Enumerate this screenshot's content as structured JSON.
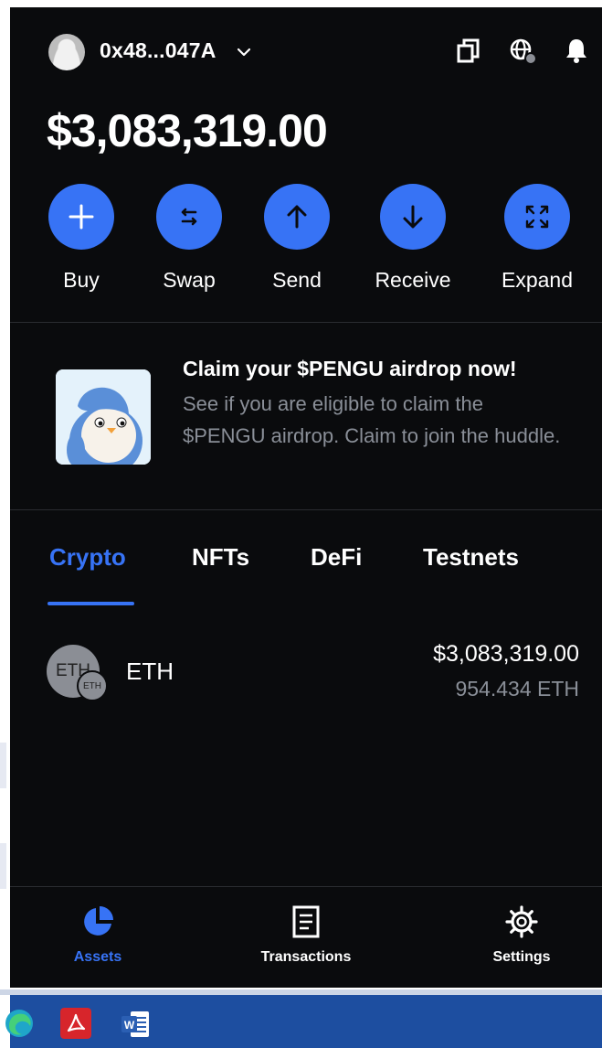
{
  "header": {
    "account_label": "0x48...047A",
    "icons": [
      "avatar",
      "chevron-down-icon",
      "copy-icon",
      "globe-icon",
      "bell-icon"
    ]
  },
  "balance": "$3,083,319.00",
  "actions": [
    {
      "label": "Buy",
      "icon": "plus-icon"
    },
    {
      "label": "Swap",
      "icon": "swap-icon"
    },
    {
      "label": "Send",
      "icon": "arrow-up-icon"
    },
    {
      "label": "Receive",
      "icon": "arrow-down-icon"
    },
    {
      "label": "Expand",
      "icon": "expand-icon"
    }
  ],
  "promo": {
    "title": "Claim your $PENGU airdrop now!",
    "description": "See if you are eligible to claim the $PENGU airdrop. Claim to join the huddle."
  },
  "tabs": [
    {
      "label": "Crypto",
      "active": true
    },
    {
      "label": "NFTs",
      "active": false
    },
    {
      "label": "DeFi",
      "active": false
    },
    {
      "label": "Testnets",
      "active": false
    }
  ],
  "assets": [
    {
      "icon_text": "ETH",
      "badge_text": "ETH",
      "name": "ETH",
      "value": "$3,083,319.00",
      "amount": "954.434 ETH"
    }
  ],
  "bottom_nav": [
    {
      "label": "Assets",
      "icon": "pie-chart-icon",
      "active": true
    },
    {
      "label": "Transactions",
      "icon": "document-icon",
      "active": false
    },
    {
      "label": "Settings",
      "icon": "gear-icon",
      "active": false
    }
  ],
  "taskbar": {
    "icons": [
      "edge-icon",
      "acrobat-icon",
      "word-icon"
    ],
    "word_letter": "W"
  },
  "colors": {
    "accent": "#3773f5",
    "background": "#0a0b0d",
    "muted_text": "#8a8f98",
    "taskbar": "#1d4ea0"
  }
}
